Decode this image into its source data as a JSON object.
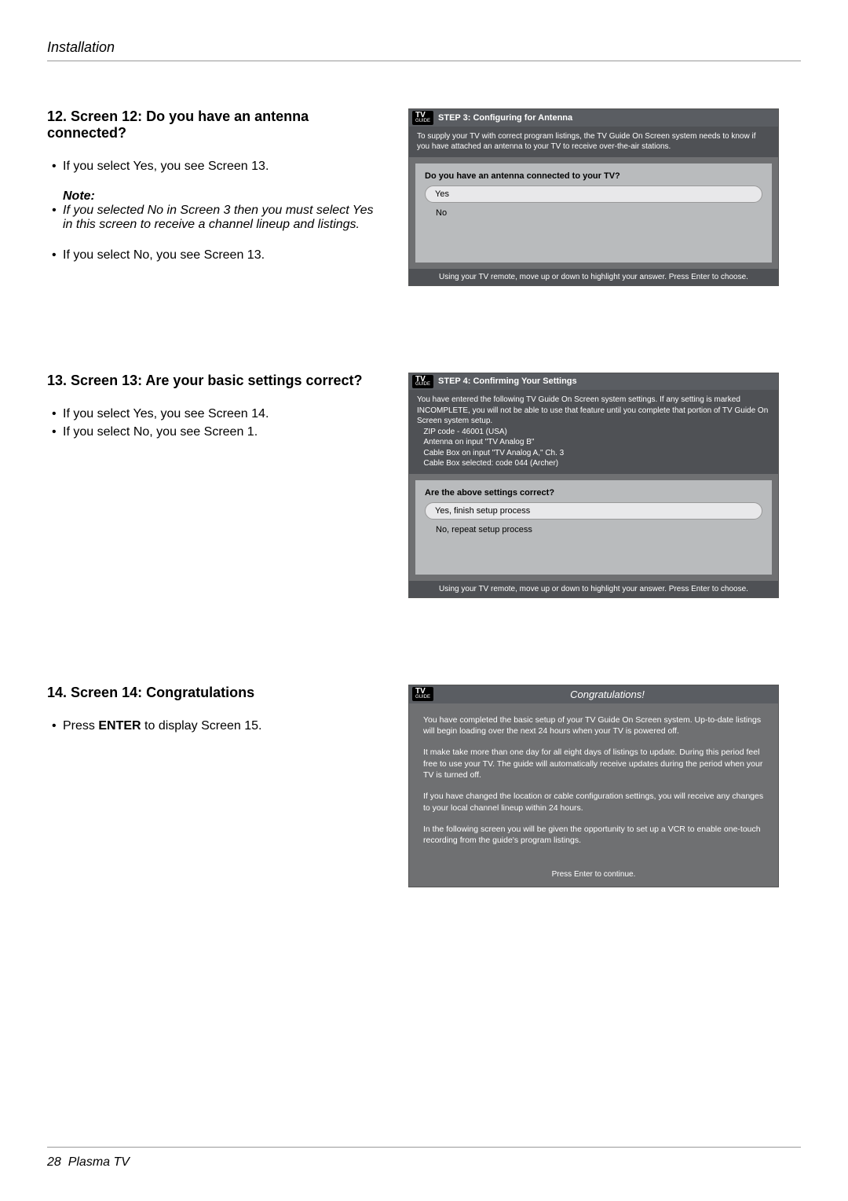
{
  "header": "Installation",
  "footer": {
    "page": "28",
    "product": "Plasma TV"
  },
  "sec12": {
    "title": "12. Screen 12: Do you have an antenna connected?",
    "b1": "If you select Yes, you see Screen 13.",
    "note_label": "Note:",
    "note_item": "If you selected No in Screen 3 then you must select Yes in this screen to receive a channel lineup and listings.",
    "b2": "If you select No, you see Screen 13.",
    "tv_step": "STEP 3: Configuring for Antenna",
    "tv_info": "To supply your TV with correct program listings, the TV Guide On Screen system needs to know if you have attached an antenna to your TV to receive over-the-air stations.",
    "tv_q": "Do you have an antenna connected to your TV?",
    "tv_opt1": "Yes",
    "tv_opt2": "No",
    "tv_foot": "Using your TV remote, move up or down to highlight your answer.  Press Enter to choose."
  },
  "sec13": {
    "title": "13. Screen 13: Are your basic settings correct?",
    "b1": "If you select Yes, you see Screen 14.",
    "b2": "If you select No, you see Screen 1.",
    "tv_step": "STEP 4: Confirming Your Settings",
    "tv_info_intro": "You have entered the following TV Guide On Screen system settings. If any setting is marked INCOMPLETE, you will not be able to use that feature until you complete that portion of TV Guide On Screen system setup.",
    "tv_info_line1": "ZIP code - 46001 (USA)",
    "tv_info_line2": "Antenna on input \"TV Analog B\"",
    "tv_info_line3": "Cable Box on input \"TV Analog A,\" Ch. 3",
    "tv_info_line4": "Cable Box selected: code 044 (Archer)",
    "tv_q": "Are the above settings correct?",
    "tv_opt1": "Yes, finish setup process",
    "tv_opt2": "No, repeat setup process",
    "tv_foot": "Using your TV remote, move up or down to highlight your answer.  Press Enter to choose."
  },
  "sec14": {
    "title": "14. Screen 14: Congratulations",
    "b1_pre": "Press ",
    "b1_bold": "ENTER",
    "b1_post": " to display Screen 15.",
    "tv_title": "Congratulations!",
    "p1": "You have completed the basic setup of your TV Guide On Screen system.  Up-to-date listings will begin loading over the next 24 hours when your TV is powered off.",
    "p2": "It make take more than one day for all eight days of listings to update.  During this period feel free to use your TV.  The guide will automatically receive updates during the period when your TV is turned off.",
    "p3": "If you have changed the location or cable configuration settings, you will receive any changes to your local channel lineup within 24 hours.",
    "p4": "In the following screen you will be given the opportunity to set up a VCR to enable one-touch recording from the guide's program listings.",
    "tv_foot": "Press Enter to continue."
  },
  "logo": {
    "line1": "TV",
    "line2": "GUIDE"
  }
}
